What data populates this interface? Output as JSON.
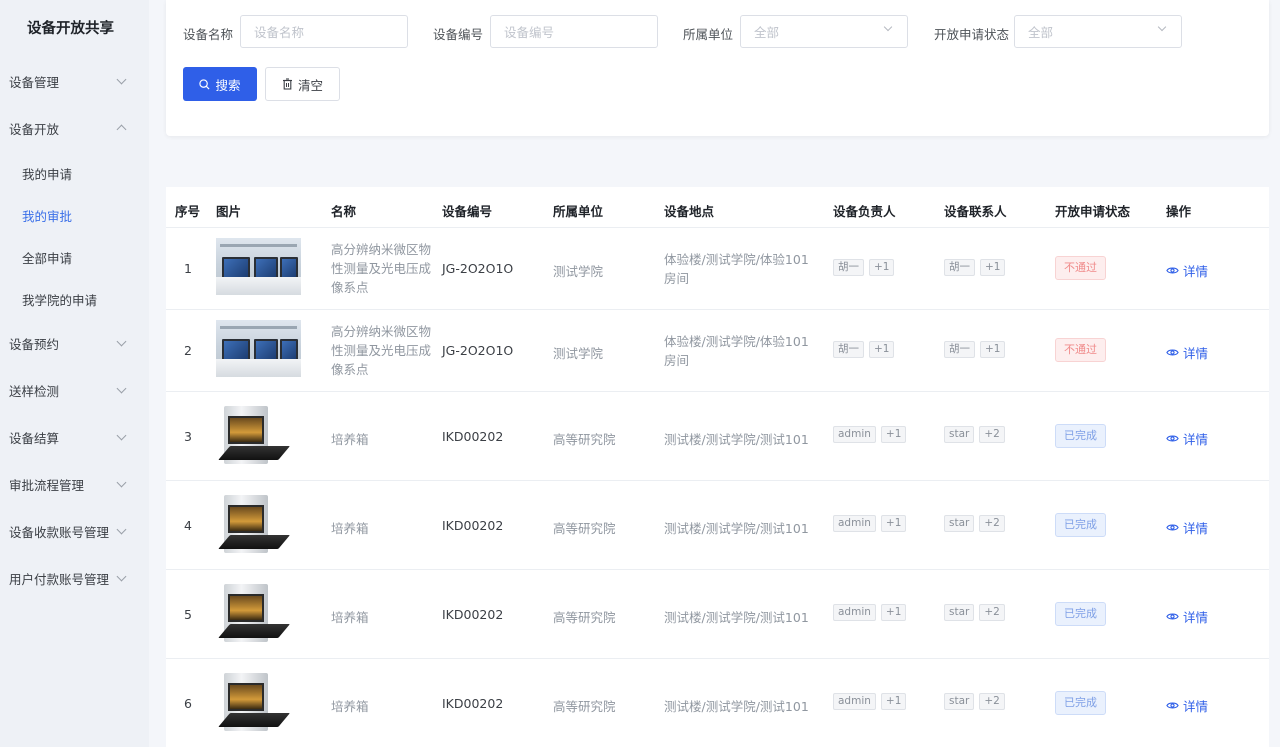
{
  "app": {
    "title": "设备开放共享"
  },
  "sidebar": {
    "items": [
      {
        "label": "设备管理",
        "expanded": false
      },
      {
        "label": "设备开放",
        "expanded": true,
        "children": [
          {
            "label": "我的申请",
            "active": false
          },
          {
            "label": "我的审批",
            "active": true
          },
          {
            "label": "全部申请",
            "active": false
          },
          {
            "label": "我学院的申请",
            "active": false
          }
        ]
      },
      {
        "label": "设备预约",
        "expanded": false
      },
      {
        "label": "送样检测",
        "expanded": false
      },
      {
        "label": "设备结算",
        "expanded": false
      },
      {
        "label": "审批流程管理",
        "expanded": false
      },
      {
        "label": "设备收款账号管理",
        "expanded": false
      },
      {
        "label": "用户付款账号管理",
        "expanded": false
      }
    ]
  },
  "filters": {
    "name": {
      "label": "设备名称",
      "placeholder": "设备名称"
    },
    "code": {
      "label": "设备编号",
      "placeholder": "设备编号"
    },
    "unit": {
      "label": "所属单位",
      "value": "全部"
    },
    "status": {
      "label": "开放申请状态",
      "value": "全部"
    },
    "search_label": "搜索",
    "clear_label": "清空"
  },
  "table": {
    "columns": [
      "序号",
      "图片",
      "名称",
      "设备编号",
      "所属单位",
      "设备地点",
      "设备负责人",
      "设备联系人",
      "开放申请状态",
      "操作"
    ],
    "rows": [
      {
        "index": "1",
        "image": "lab-workstation",
        "name": "高分辨纳米微区物性测量及光电压成像系点",
        "code": "JG-2O2O1O",
        "unit": "测试学院",
        "location": "体验楼/测试学院/体验101房间",
        "owner": "胡一",
        "owner_more": "+1",
        "contact": "胡一",
        "contact_more": "+1",
        "status": "不通过",
        "status_type": "rejected",
        "action": "详情"
      },
      {
        "index": "2",
        "image": "lab-workstation",
        "name": "高分辨纳米微区物性测量及光电压成像系点",
        "code": "JG-2O2O1O",
        "unit": "测试学院",
        "location": "体验楼/测试学院/体验101房间",
        "owner": "胡一",
        "owner_more": "+1",
        "contact": "胡一",
        "contact_more": "+1",
        "status": "不通过",
        "status_type": "rejected",
        "action": "详情"
      },
      {
        "index": "3",
        "image": "incubator-oven",
        "name": "培养箱",
        "code": "IKD00202",
        "unit": "高等研究院",
        "location": "测试楼/测试学院/测试101",
        "owner": "admin",
        "owner_more": "+1",
        "contact": "star",
        "contact_more": "+2",
        "status": "已完成",
        "status_type": "done",
        "action": "详情"
      },
      {
        "index": "4",
        "image": "incubator-oven",
        "name": "培养箱",
        "code": "IKD00202",
        "unit": "高等研究院",
        "location": "测试楼/测试学院/测试101",
        "owner": "admin",
        "owner_more": "+1",
        "contact": "star",
        "contact_more": "+2",
        "status": "已完成",
        "status_type": "done",
        "action": "详情"
      },
      {
        "index": "5",
        "image": "incubator-oven",
        "name": "培养箱",
        "code": "IKD00202",
        "unit": "高等研究院",
        "location": "测试楼/测试学院/测试101",
        "owner": "admin",
        "owner_more": "+1",
        "contact": "star",
        "contact_more": "+2",
        "status": "已完成",
        "status_type": "done",
        "action": "详情"
      },
      {
        "index": "6",
        "image": "incubator-oven",
        "name": "培养箱",
        "code": "IKD00202",
        "unit": "高等研究院",
        "location": "测试楼/测试学院/测试101",
        "owner": "admin",
        "owner_more": "+1",
        "contact": "star",
        "contact_more": "+2",
        "status": "已完成",
        "status_type": "done",
        "action": "详情"
      }
    ]
  },
  "colors": {
    "primary": "#2f5fe8",
    "active_menu": "#3a6fe8",
    "rejected": "#f08b8b",
    "done": "#7fa0e6"
  },
  "icons": {
    "search": "search-icon",
    "clear": "trash-icon",
    "detail": "eye-icon",
    "expand": "chevron-down-icon",
    "collapse": "chevron-up-icon"
  }
}
